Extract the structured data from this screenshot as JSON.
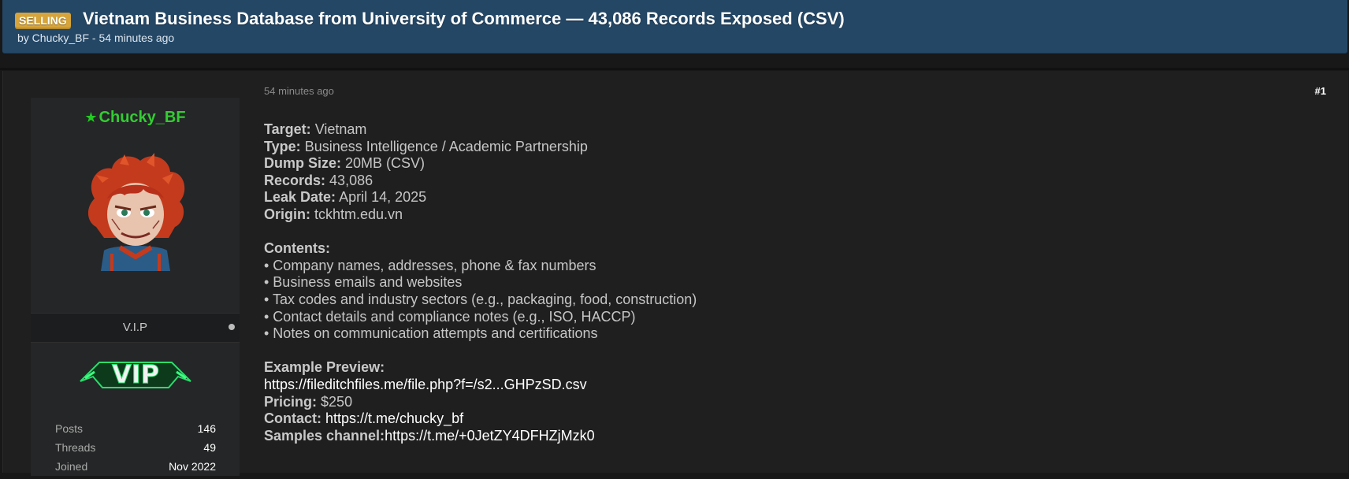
{
  "thread": {
    "badge": "SELLING",
    "title": "Vietnam Business Database from University of Commerce — 43,086 Records Exposed (CSV)",
    "meta": "by Chucky_BF - 54 minutes ago"
  },
  "post": {
    "time": "54 minutes ago",
    "number": "#1",
    "fields": {
      "target_label": "Target:",
      "target_value": "Vietnam",
      "type_label": "Type:",
      "type_value": "Business Intelligence / Academic Partnership",
      "dump_label": "Dump Size:",
      "dump_value": "20MB (CSV)",
      "records_label": "Records:",
      "records_value": "43,086",
      "leak_label": "Leak Date:",
      "leak_value": "April 14, 2025",
      "origin_label": "Origin:",
      "origin_value": "tckhtm.edu.vn"
    },
    "contents_label": "Contents:",
    "contents": [
      "• Company names, addresses, phone & fax numbers",
      "• Business emails and websites",
      "• Tax codes and industry sectors (e.g., packaging, food, construction)",
      "• Contact details and compliance notes (e.g., ISO, HACCP)",
      "• Notes on communication attempts and certifications"
    ],
    "preview_label": "Example Preview:",
    "preview_link": "https://fileditchfiles.me/file.php?f=/s2...GHPzSD.csv",
    "pricing_label": "Pricing:",
    "pricing_value": "$250",
    "contact_label": "Contact:",
    "contact_link": "https://t.me/chucky_bf",
    "samples_label": "Samples channel:",
    "samples_link": "https://t.me/+0JetZY4DFHZjMzk0"
  },
  "user": {
    "username": "Chucky_BF",
    "username_icon": "star-icon",
    "rank": "V.I.P",
    "stats": [
      {
        "label": "Posts",
        "value": "146"
      },
      {
        "label": "Threads",
        "value": "49"
      },
      {
        "label": "Joined",
        "value": "Nov 2022"
      }
    ]
  },
  "colors": {
    "header_bg": "#244766",
    "badge_bg": "#d6a43a",
    "username": "#33cc33",
    "post_bg": "#1f1f1f",
    "panel_bg": "#252627"
  }
}
